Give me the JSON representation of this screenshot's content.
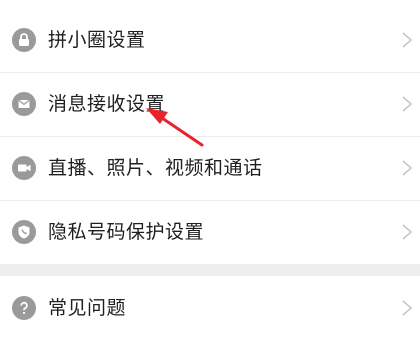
{
  "settings_group": {
    "items": [
      {
        "label": "拼小圈设置",
        "icon": "lock-icon"
      },
      {
        "label": "消息接收设置",
        "icon": "mail-icon"
      },
      {
        "label": "直播、照片、视频和通话",
        "icon": "video-camera-icon"
      },
      {
        "label": "隐私号码保护设置",
        "icon": "shield-phone-icon"
      }
    ]
  },
  "help_group": {
    "items": [
      {
        "label": "常见问题",
        "icon": "question-icon"
      }
    ]
  },
  "colors": {
    "icon_gray": "#9a9a9a",
    "chevron_gray": "#c8c8c8",
    "annotation_red": "#e8232a",
    "divider": "#eeeeee"
  }
}
